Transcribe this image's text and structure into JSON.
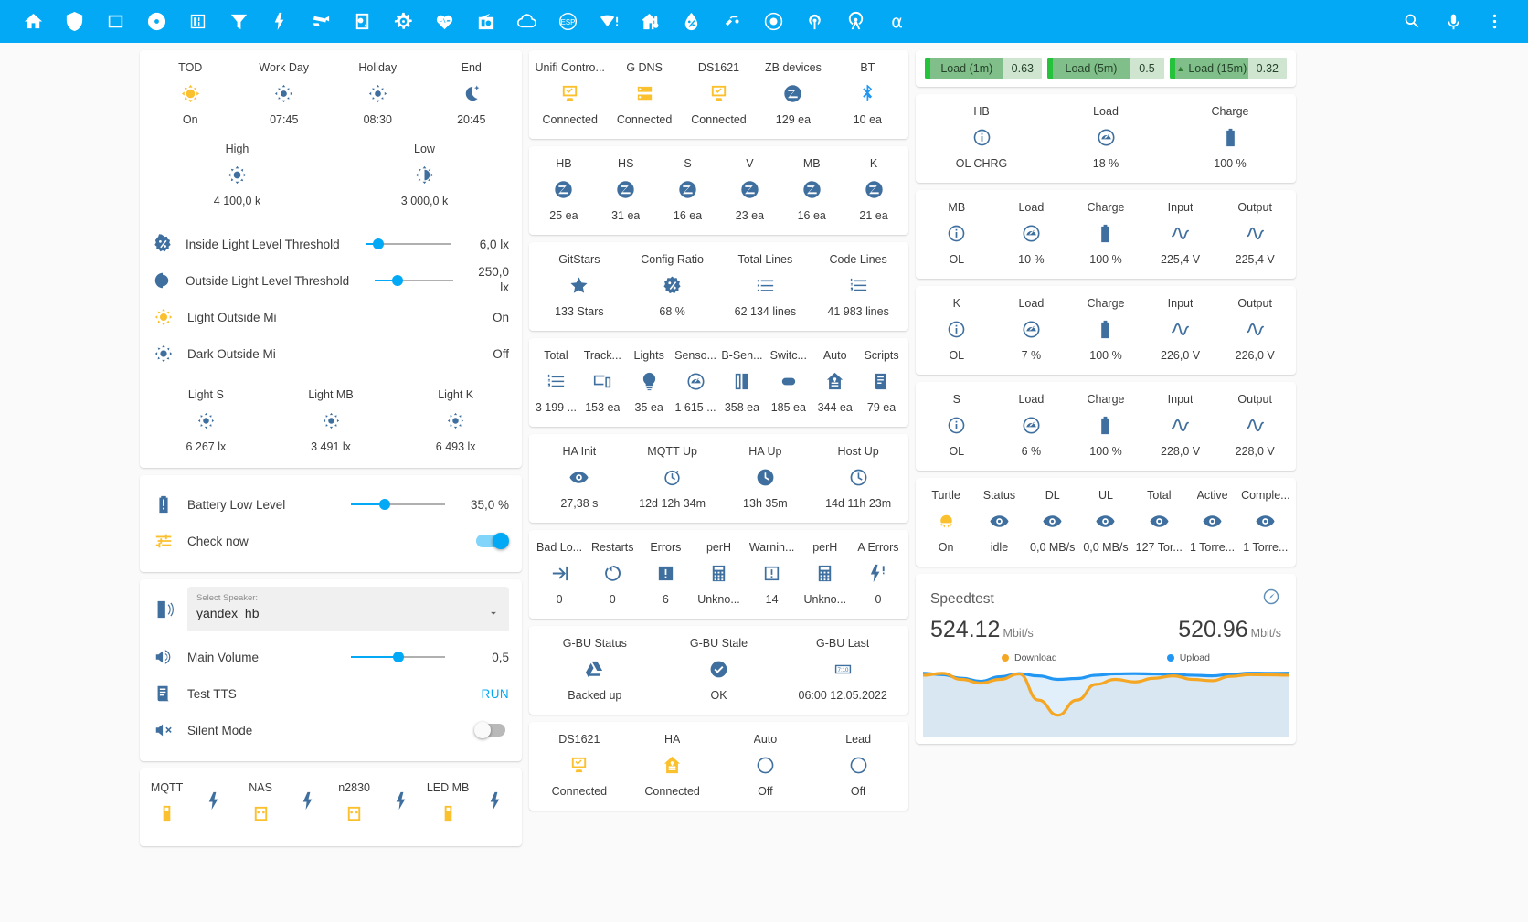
{
  "appbar": {
    "icons": [
      {
        "name": "home-icon"
      },
      {
        "name": "shield-icon"
      },
      {
        "name": "window-icon"
      },
      {
        "name": "disc-icon"
      },
      {
        "name": "meter-icon"
      },
      {
        "name": "filter-icon"
      },
      {
        "name": "lightning-icon"
      },
      {
        "name": "cctv-icon"
      },
      {
        "name": "camera-doorbell-icon"
      },
      {
        "name": "gear-icon"
      },
      {
        "name": "heart-pulse-icon"
      },
      {
        "name": "radio-icon"
      },
      {
        "name": "cloud-icon"
      },
      {
        "name": "esp-icon"
      },
      {
        "name": "wifi-alert-icon"
      },
      {
        "name": "home-thermometer-icon"
      },
      {
        "name": "water-percent-icon"
      },
      {
        "name": "toggle-switch-icon"
      },
      {
        "name": "record-circle-icon"
      },
      {
        "name": "access-point-icon"
      },
      {
        "name": "broadcast-icon"
      }
    ],
    "right": [
      {
        "name": "search-icon"
      },
      {
        "name": "microphone-icon"
      },
      {
        "name": "overflow-menu-icon"
      }
    ],
    "alpha_label": "α"
  },
  "col1": {
    "light_card": {
      "glance_top": [
        {
          "name": "TOD",
          "icon": "sun-icon",
          "state": "On",
          "color": "amber"
        },
        {
          "name": "Work Day",
          "icon": "brightness-auto-icon",
          "state": "07:45",
          "color": "blue"
        },
        {
          "name": "Holiday",
          "icon": "brightness-auto-icon",
          "state": "08:30",
          "color": "blue"
        },
        {
          "name": "End",
          "icon": "moon-star-icon",
          "state": "20:45",
          "color": "blue"
        }
      ],
      "glance_mid": [
        {
          "name": "High",
          "icon": "brightness-icon",
          "state": "4 100,0 k",
          "color": "blue"
        },
        {
          "name": "Low",
          "icon": "brightness-half-icon",
          "state": "3 000,0 k",
          "color": "blue"
        }
      ],
      "rows": [
        {
          "icon": "brightness-percent-icon",
          "color": "blue",
          "label": "Inside Light Level Threshold",
          "control": "slider",
          "slider_pct": 15,
          "value": "6,0 lx"
        },
        {
          "icon": "brightness-contrast-icon",
          "color": "blue",
          "label": "Outside Light Level Threshold",
          "control": "slider",
          "slider_pct": 29,
          "value": "250,0 lx"
        },
        {
          "icon": "sun-icon",
          "color": "amber",
          "label": "Light Outside Mi",
          "control": "none",
          "value": "On"
        },
        {
          "icon": "brightness-icon",
          "color": "blue",
          "label": "Dark Outside Mi",
          "control": "none",
          "value": "Off"
        }
      ],
      "glance_bottom": [
        {
          "name": "Light S",
          "icon": "brightness-icon",
          "state": "6 267 lx",
          "color": "blue"
        },
        {
          "name": "Light MB",
          "icon": "brightness-icon",
          "state": "3 491 lx",
          "color": "blue"
        },
        {
          "name": "Light K",
          "icon": "brightness-icon",
          "state": "6 493 lx",
          "color": "blue"
        }
      ]
    },
    "battery_card": {
      "rows": [
        {
          "icon": "battery-alert-icon",
          "color": "blue",
          "label": "Battery Low Level",
          "control": "slider",
          "slider_pct": 36,
          "value": "35,0 %"
        },
        {
          "icon": "tune-icon",
          "color": "amber",
          "label": "Check now",
          "control": "toggle",
          "toggle": "on",
          "value": ""
        }
      ]
    },
    "speaker_card": {
      "select": {
        "icon": "speaker-icon",
        "label": "Select Speaker:",
        "value": "yandex_hb"
      },
      "rows": [
        {
          "icon": "volume-high-icon",
          "color": "blue",
          "label": "Main Volume",
          "control": "slider",
          "slider_pct": 50,
          "value": "0,5"
        },
        {
          "icon": "script-text-icon",
          "color": "blue",
          "label": "Test TTS",
          "control": "run",
          "value": "RUN"
        },
        {
          "icon": "volume-off-icon",
          "color": "blue",
          "label": "Silent Mode",
          "control": "toggle",
          "toggle": "off",
          "value": ""
        }
      ]
    },
    "power_card": {
      "glance": [
        {
          "name": "MQTT",
          "icon": "power-plug-battery-icon",
          "state": "",
          "color": "amber"
        },
        {
          "name": "",
          "icon": "lightning-icon",
          "state": "",
          "color": "blue"
        },
        {
          "name": "NAS",
          "icon": "power-socket-icon",
          "state": "",
          "color": "amber"
        },
        {
          "name": "",
          "icon": "lightning-icon",
          "state": "",
          "color": "blue"
        },
        {
          "name": "n2830",
          "icon": "power-socket-icon",
          "state": "",
          "color": "amber"
        },
        {
          "name": "",
          "icon": "lightning-icon",
          "state": "",
          "color": "blue"
        },
        {
          "name": "LED MB",
          "icon": "power-plug-battery-icon",
          "state": "",
          "color": "amber"
        },
        {
          "name": "",
          "icon": "lightning-icon",
          "state": "",
          "color": "blue"
        }
      ]
    }
  },
  "col2": {
    "network_card": [
      {
        "name": "Unifi Contro...",
        "icon": "monitor-check-icon",
        "state": "Connected",
        "color": "amber"
      },
      {
        "name": "G DNS",
        "icon": "server-icon",
        "state": "Connected",
        "color": "amber"
      },
      {
        "name": "DS1621",
        "icon": "monitor-check-icon",
        "state": "Connected",
        "color": "amber"
      },
      {
        "name": "ZB devices",
        "icon": "zigbee-icon",
        "state": "129 ea",
        "color": "blue"
      },
      {
        "name": "BT",
        "icon": "bluetooth-icon",
        "state": "10 ea",
        "color": "ltblue"
      }
    ],
    "zigbee_card": [
      {
        "name": "HB",
        "icon": "zigbee-icon",
        "state": "25 ea",
        "color": "blue"
      },
      {
        "name": "HS",
        "icon": "zigbee-icon",
        "state": "31 ea",
        "color": "blue"
      },
      {
        "name": "S",
        "icon": "zigbee-icon",
        "state": "16 ea",
        "color": "blue"
      },
      {
        "name": "V",
        "icon": "zigbee-icon",
        "state": "23 ea",
        "color": "blue"
      },
      {
        "name": "MB",
        "icon": "zigbee-icon",
        "state": "16 ea",
        "color": "blue"
      },
      {
        "name": "K",
        "icon": "zigbee-icon",
        "state": "21 ea",
        "color": "blue"
      }
    ],
    "git_card": [
      {
        "name": "GitStars",
        "icon": "star-icon",
        "state": "133 Stars",
        "color": "blue"
      },
      {
        "name": "Config Ratio",
        "icon": "brightness-percent-icon",
        "state": "68 %",
        "color": "blue"
      },
      {
        "name": "Total Lines",
        "icon": "format-list-icon",
        "state": "62 134 lines",
        "color": "blue"
      },
      {
        "name": "Code Lines",
        "icon": "format-list-numbered-icon",
        "state": "41 983 lines",
        "color": "blue"
      }
    ],
    "entities_card": [
      {
        "name": "Total",
        "icon": "format-list-numbered-icon",
        "state": "3 199 ...",
        "color": "blue"
      },
      {
        "name": "Track...",
        "icon": "devices-icon",
        "state": "153 ea",
        "color": "blue"
      },
      {
        "name": "Lights",
        "icon": "lightbulb-icon",
        "state": "35 ea",
        "color": "blue"
      },
      {
        "name": "Senso...",
        "icon": "gauge-icon",
        "state": "1 615 ...",
        "color": "blue"
      },
      {
        "name": "B-Sen...",
        "icon": "binary-sensor-icon",
        "state": "358 ea",
        "color": "blue"
      },
      {
        "name": "Switc...",
        "icon": "toggle-switch-icon",
        "state": "185 ea",
        "color": "blue"
      },
      {
        "name": "Auto",
        "icon": "home-automation-icon",
        "state": "344 ea",
        "color": "blue"
      },
      {
        "name": "Scripts",
        "icon": "script-text-icon",
        "state": "79 ea",
        "color": "blue"
      }
    ],
    "uptime_card": [
      {
        "name": "HA Init",
        "icon": "eye-icon",
        "state": "27,38 s",
        "color": "blue"
      },
      {
        "name": "MQTT Up",
        "icon": "timer-icon",
        "state": "12d 12h 34m",
        "color": "blue"
      },
      {
        "name": "HA Up",
        "icon": "clock-filled-icon",
        "state": "13h 35m",
        "color": "blue"
      },
      {
        "name": "Host Up",
        "icon": "clock-outline-icon",
        "state": "14d 11h 23m",
        "color": "blue"
      }
    ],
    "errors_card": [
      {
        "name": "Bad Lo...",
        "icon": "login-icon",
        "state": "0",
        "color": "blue"
      },
      {
        "name": "Restarts",
        "icon": "restart-icon",
        "state": "0",
        "color": "blue"
      },
      {
        "name": "Errors",
        "icon": "alert-box-filled-icon",
        "state": "6",
        "color": "blue"
      },
      {
        "name": "perH",
        "icon": "calculator-icon",
        "state": "Unkno...",
        "color": "blue"
      },
      {
        "name": "Warnin...",
        "icon": "alert-box-outline-icon",
        "state": "14",
        "color": "blue"
      },
      {
        "name": "perH",
        "icon": "calculator-icon",
        "state": "Unkno...",
        "color": "blue"
      },
      {
        "name": "A Errors",
        "icon": "flash-alert-icon",
        "state": "0",
        "color": "blue"
      }
    ],
    "backup_card": [
      {
        "name": "G-BU Status",
        "icon": "google-drive-icon",
        "state": "Backed up",
        "color": "blue"
      },
      {
        "name": "G-BU Stale",
        "icon": "check-circle-icon",
        "state": "OK",
        "color": "blue"
      },
      {
        "name": "G-BU Last",
        "icon": "clock-digital-icon",
        "state": "06:00 12.05.2022",
        "color": "blue"
      }
    ],
    "status_card": [
      {
        "name": "DS1621",
        "icon": "monitor-check-icon",
        "state": "Connected",
        "color": "amber"
      },
      {
        "name": "HA",
        "icon": "home-automation-icon",
        "state": "Connected",
        "color": "amber"
      },
      {
        "name": "Auto",
        "icon": "circle-outline-icon",
        "state": "Off",
        "color": "blue"
      },
      {
        "name": "Lead",
        "icon": "circle-outline-icon",
        "state": "Off",
        "color": "blue"
      }
    ]
  },
  "col3": {
    "load_badges": [
      {
        "name": "Load (1m)",
        "value": "0.63",
        "triangle": false
      },
      {
        "name": "Load (5m)",
        "value": "0.5",
        "triangle": false
      },
      {
        "name": "Load (15m)",
        "value": "0.32",
        "triangle": true
      }
    ],
    "ups_hb": [
      {
        "name": "HB",
        "icon": "information-icon",
        "state": "OL CHRG",
        "color": "blue"
      },
      {
        "name": "Load",
        "icon": "gauge-icon",
        "state": "18 %",
        "color": "blue"
      },
      {
        "name": "Charge",
        "icon": "battery-icon",
        "state": "100 %",
        "color": "blue"
      }
    ],
    "ups_mb": [
      {
        "name": "MB",
        "icon": "information-icon",
        "state": "OL",
        "color": "blue"
      },
      {
        "name": "Load",
        "icon": "gauge-icon",
        "state": "10 %",
        "color": "blue"
      },
      {
        "name": "Charge",
        "icon": "battery-icon",
        "state": "100 %",
        "color": "blue"
      },
      {
        "name": "Input",
        "icon": "sine-wave-icon",
        "state": "225,4 V",
        "color": "blue"
      },
      {
        "name": "Output",
        "icon": "sine-wave-icon",
        "state": "225,4 V",
        "color": "blue"
      }
    ],
    "ups_k": [
      {
        "name": "K",
        "icon": "information-icon",
        "state": "OL",
        "color": "blue"
      },
      {
        "name": "Load",
        "icon": "gauge-icon",
        "state": "7 %",
        "color": "blue"
      },
      {
        "name": "Charge",
        "icon": "battery-icon",
        "state": "100 %",
        "color": "blue"
      },
      {
        "name": "Input",
        "icon": "sine-wave-icon",
        "state": "226,0 V",
        "color": "blue"
      },
      {
        "name": "Output",
        "icon": "sine-wave-icon",
        "state": "226,0 V",
        "color": "blue"
      }
    ],
    "ups_s": [
      {
        "name": "S",
        "icon": "information-icon",
        "state": "OL",
        "color": "blue"
      },
      {
        "name": "Load",
        "icon": "gauge-icon",
        "state": "6 %",
        "color": "blue"
      },
      {
        "name": "Charge",
        "icon": "battery-icon",
        "state": "100 %",
        "color": "blue"
      },
      {
        "name": "Input",
        "icon": "sine-wave-icon",
        "state": "228,0 V",
        "color": "blue"
      },
      {
        "name": "Output",
        "icon": "sine-wave-icon",
        "state": "228,0 V",
        "color": "blue"
      }
    ],
    "torrent_card": [
      {
        "name": "Turtle",
        "icon": "turtle-icon",
        "state": "On",
        "color": "amber"
      },
      {
        "name": "Status",
        "icon": "eye-icon",
        "state": "idle",
        "color": "blue"
      },
      {
        "name": "DL",
        "icon": "eye-icon",
        "state": "0,0 MB/s",
        "color": "blue"
      },
      {
        "name": "UL",
        "icon": "eye-icon",
        "state": "0,0 MB/s",
        "color": "blue"
      },
      {
        "name": "Total",
        "icon": "eye-icon",
        "state": "127 Tor...",
        "color": "blue"
      },
      {
        "name": "Active",
        "icon": "eye-icon",
        "state": "1 Torre...",
        "color": "blue"
      },
      {
        "name": "Comple...",
        "icon": "eye-icon",
        "state": "1 Torre...",
        "color": "blue"
      }
    ],
    "speedtest": {
      "title": "Speedtest",
      "download_value": "524.12",
      "download_unit": "Mbit/s",
      "upload_value": "520.96",
      "upload_unit": "Mbit/s",
      "legend": [
        {
          "label": "Download",
          "color": "#f5a623"
        },
        {
          "label": "Upload",
          "color": "#2196f3"
        }
      ]
    }
  },
  "chart_data": {
    "type": "area",
    "title": "Speedtest",
    "ylabel": "Mbit/s",
    "grid": false,
    "legend_position": "top-center",
    "series": [
      {
        "name": "Download",
        "color": "#f5a623",
        "values": [
          505,
          520,
          470,
          440,
          470,
          515,
          300,
          175,
          300,
          430,
          470,
          450,
          480,
          500,
          470,
          460,
          495,
          510,
          508,
          505
        ]
      },
      {
        "name": "Upload",
        "color": "#2196f3",
        "values": [
          520,
          510,
          480,
          455,
          492,
          518,
          500,
          470,
          478,
          505,
          516,
          518,
          515,
          512,
          505,
          500,
          512,
          522,
          520,
          521
        ]
      }
    ],
    "ylim": [
      0,
      540
    ]
  }
}
